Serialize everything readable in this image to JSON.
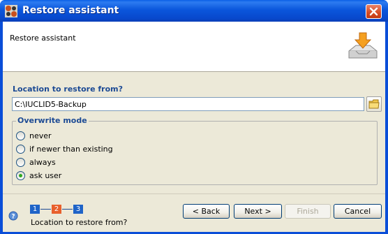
{
  "window": {
    "title": "Restore assistant"
  },
  "header": {
    "title": "Restore assistant"
  },
  "location": {
    "label": "Location to restore from?",
    "value": "C:\\IUCLID5-Backup"
  },
  "overwrite": {
    "legend": "Overwrite mode",
    "options": [
      {
        "label": "never",
        "checked": false
      },
      {
        "label": "if newer than existing",
        "checked": false
      },
      {
        "label": "always",
        "checked": false
      },
      {
        "label": "ask user",
        "checked": true
      }
    ]
  },
  "steps": {
    "items": [
      "1",
      "2",
      "3"
    ],
    "current": 2,
    "caption": "Location to restore from?",
    "colors": {
      "inactive": "#1f64c8",
      "active": "#e8602c"
    }
  },
  "buttons": {
    "back": "< Back",
    "next": "Next >",
    "finish": "Finish",
    "cancel": "Cancel"
  }
}
